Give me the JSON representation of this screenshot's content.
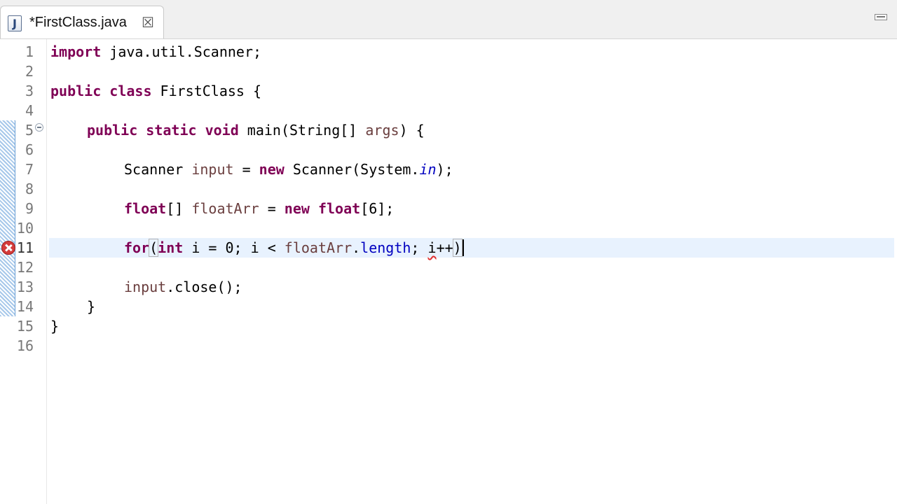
{
  "tab": {
    "title": "*FirstClass.java",
    "icon_letter": "J",
    "close_glyph": "☒"
  },
  "editor": {
    "line_numbers": [
      "1",
      "2",
      "3",
      "4",
      "5",
      "6",
      "7",
      "8",
      "9",
      "10",
      "11",
      "12",
      "13",
      "14",
      "15",
      "16"
    ],
    "lines": {
      "l1": {
        "kw": "import",
        "rest": " java.util.Scanner;"
      },
      "l3": {
        "kw1": "public",
        "kw2": "class",
        "rest": " FirstClass {"
      },
      "l5": {
        "kw1": "public",
        "kw2": "static",
        "kw3": "void",
        "name": " main(String[] ",
        "param": "args",
        "end": ") {"
      },
      "l7": {
        "type": "Scanner ",
        "var": "input",
        "eq": " = ",
        "kw": "new",
        "ctor": " Scanner(System.",
        "field": "in",
        "end": ");"
      },
      "l9": {
        "kw1": "float",
        "brackets": "[] ",
        "var": "floatArr",
        "eq": " = ",
        "kw2": "new",
        "sp": " ",
        "kw3": "float",
        "end": "[6];"
      },
      "l11": {
        "kw1": "for",
        "paren": "(",
        "kw2": "int",
        "mid1": " i = 0; i < ",
        "var": "floatArr",
        "dot": ".",
        "field": "length",
        "mid2": "; ",
        "err": "i",
        "tail": "++",
        "close": ")"
      },
      "l13": {
        "var": "input",
        "rest": ".close();"
      },
      "l14": {
        "text": "}"
      },
      "l15": {
        "text": "}"
      }
    },
    "error_line": "11",
    "colors": {
      "keyword": "#7f0055",
      "local_var": "#6a3e3e",
      "field": "#0000c0",
      "error": "#d43b3b",
      "current_line": "#e8f2fe"
    }
  }
}
